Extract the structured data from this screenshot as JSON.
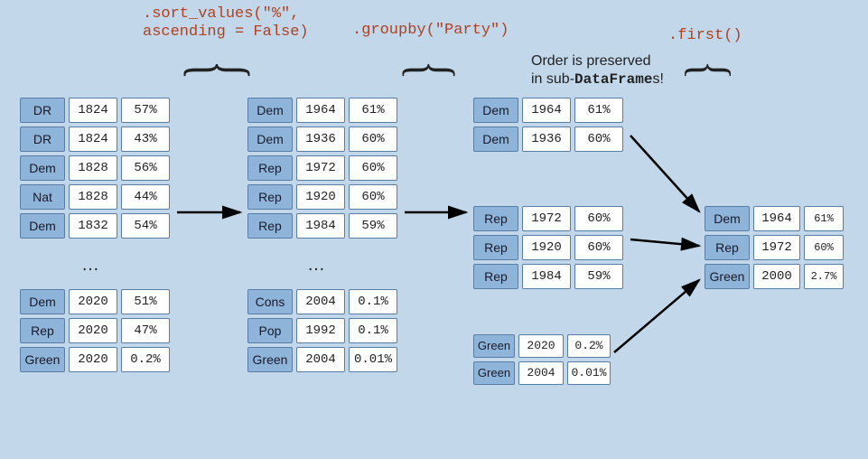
{
  "labels": {
    "sort": ".sort_values(\"%\",\nascending = False)",
    "groupby": ".groupby(\"Party\")",
    "first": ".first()"
  },
  "note_line1": "Order is preserved",
  "note_line2_a": "in sub-",
  "note_line2_b": "DataFrame",
  "note_line2_c": "s!",
  "ellipsis": "…",
  "tables": {
    "orig_top": [
      {
        "party": "DR",
        "year": "1824",
        "pct": "57%"
      },
      {
        "party": "DR",
        "year": "1824",
        "pct": "43%"
      },
      {
        "party": "Dem",
        "year": "1828",
        "pct": "56%"
      },
      {
        "party": "Nat",
        "year": "1828",
        "pct": "44%"
      },
      {
        "party": "Dem",
        "year": "1832",
        "pct": "54%"
      }
    ],
    "orig_bot": [
      {
        "party": "Dem",
        "year": "2020",
        "pct": "51%"
      },
      {
        "party": "Rep",
        "year": "2020",
        "pct": "47%"
      },
      {
        "party": "Green",
        "year": "2020",
        "pct": "0.2%"
      }
    ],
    "sorted_top": [
      {
        "party": "Dem",
        "year": "1964",
        "pct": "61%"
      },
      {
        "party": "Dem",
        "year": "1936",
        "pct": "60%"
      },
      {
        "party": "Rep",
        "year": "1972",
        "pct": "60%"
      },
      {
        "party": "Rep",
        "year": "1920",
        "pct": "60%"
      },
      {
        "party": "Rep",
        "year": "1984",
        "pct": "59%"
      }
    ],
    "sorted_bot": [
      {
        "party": "Cons",
        "year": "2004",
        "pct": "0.1%"
      },
      {
        "party": "Pop",
        "year": "1992",
        "pct": "0.1%"
      },
      {
        "party": "Green",
        "year": "2004",
        "pct": "0.01%"
      }
    ],
    "group_dem": [
      {
        "party": "Dem",
        "year": "1964",
        "pct": "61%"
      },
      {
        "party": "Dem",
        "year": "1936",
        "pct": "60%"
      }
    ],
    "group_rep": [
      {
        "party": "Rep",
        "year": "1972",
        "pct": "60%"
      },
      {
        "party": "Rep",
        "year": "1920",
        "pct": "60%"
      },
      {
        "party": "Rep",
        "year": "1984",
        "pct": "59%"
      }
    ],
    "group_green": [
      {
        "party": "Green",
        "year": "2020",
        "pct": "0.2%"
      },
      {
        "party": "Green",
        "year": "2004",
        "pct": "0.01%"
      }
    ],
    "result": [
      {
        "party": "Dem",
        "year": "1964",
        "pct": "61%"
      },
      {
        "party": "Rep",
        "year": "1972",
        "pct": "60%"
      },
      {
        "party": "Green",
        "year": "2000",
        "pct": "2.7%"
      }
    ]
  }
}
